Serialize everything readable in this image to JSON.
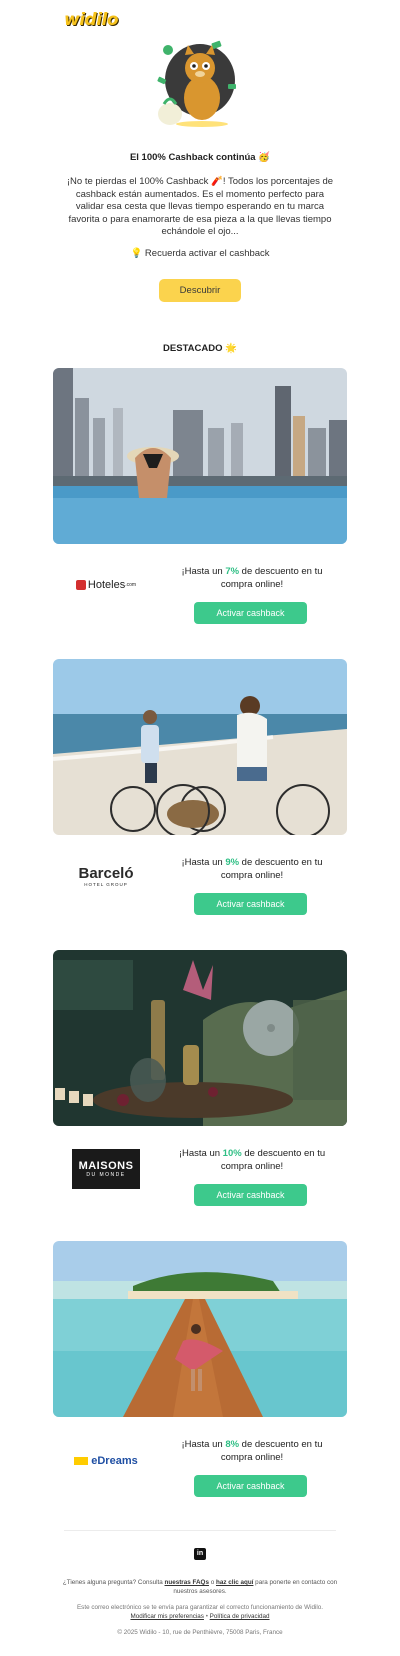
{
  "header": {
    "logo_text": "widilo"
  },
  "intro": {
    "title": "El 100% Cashback continúa 🥳",
    "body": "¡No te pierdas el 100% Cashback 🧨! Todos los porcentajes de cashback están aumentados. Es el momento perfecto para validar esa cesta que llevas tiempo esperando en tu marca favorita o para enamorarte de esa pieza a la que llevas tiempo echándole el ojo...",
    "reminder": "💡 Recuerda activar el cashback",
    "cta_label": "Descubrir"
  },
  "featured": {
    "title": "DESTACADO 🌟"
  },
  "offers": [
    {
      "brand": "Hoteles",
      "brand_suffix": ".com",
      "text_before": "¡Hasta un ",
      "percent": "7%",
      "text_after": " de descuento en tu compra online!",
      "button_label": "Activar cashback",
      "image": "city-infinity-pool"
    },
    {
      "brand": "Barceló",
      "brand_sub": "HOTEL GROUP",
      "text_before": "¡Hasta un ",
      "percent": "9%",
      "text_after": " de descuento en tu compra online!",
      "button_label": "Activar cashback",
      "image": "beach-bike-couple"
    },
    {
      "brand": "MAISONS",
      "brand_sub": "DU MONDE",
      "text_before": "¡Hasta un ",
      "percent": "10%",
      "text_after": " de descuento en tu compra online!",
      "button_label": "Activar cashback",
      "image": "living-room-decor"
    },
    {
      "brand": "eDreams",
      "text_before": "¡Hasta un ",
      "percent": "8%",
      "text_after": " de descuento en tu compra online!",
      "button_label": "Activar cashback",
      "image": "tropical-pier"
    }
  ],
  "footer": {
    "social_icon": "linkedin-icon",
    "question_before": "¿Tienes alguna pregunta? Consulta ",
    "faq_link": "nuestras FAQs",
    "question_mid": " o ",
    "contact_link": "haz clic aquí",
    "question_after": " para ponerte en contacto con nuestros asesores.",
    "notice": "Este correo electrónico se te envía para garantizar el correcto funcionamiento de Widilo.",
    "prefs_link": "Modificar mis preferencias",
    "separator": " • ",
    "privacy_link": "Política de privacidad",
    "copyright": "© 2025 Widilo - 10, rue de Penthièvre, 75008 Paris, France"
  },
  "colors": {
    "accent_yellow": "#fbd34d",
    "accent_green": "#3dc98c",
    "percent_green": "#2fbf85"
  }
}
